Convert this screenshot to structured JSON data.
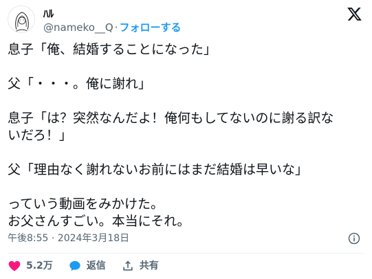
{
  "author": {
    "display_name": "ﾊﾙ",
    "handle": "@nameko__Q",
    "separator": "·",
    "follow_label": "フォローする"
  },
  "tweet": {
    "lines": [
      "息子「俺、結婚することになった」",
      "",
      "父「・・・。俺に謝れ」",
      "",
      "息子「は？突然なんだよ！俺何もしてないのに謝る訳な",
      "いだろ！」",
      "",
      "父「理由なく謝れないお前にはまだ結婚は早いな」",
      "",
      "っていう動画をみかけた。",
      "お父さんすごい。本当にそれ。"
    ]
  },
  "meta": {
    "timestamp": "午後8:55 · 2024年3月18日"
  },
  "actions": {
    "like_count": "5.2万",
    "reply_label": "返信",
    "share_label": "共有"
  },
  "colors": {
    "text": "#0f1419",
    "secondary": "#536471",
    "accent": "#1d9bf0",
    "like": "#f91880",
    "divider": "#eff3f4"
  },
  "icons": {
    "logo": "x-logo-icon",
    "info": "info-icon",
    "like": "heart-icon",
    "reply": "speech-bubble-icon",
    "share": "share-arrow-icon"
  }
}
